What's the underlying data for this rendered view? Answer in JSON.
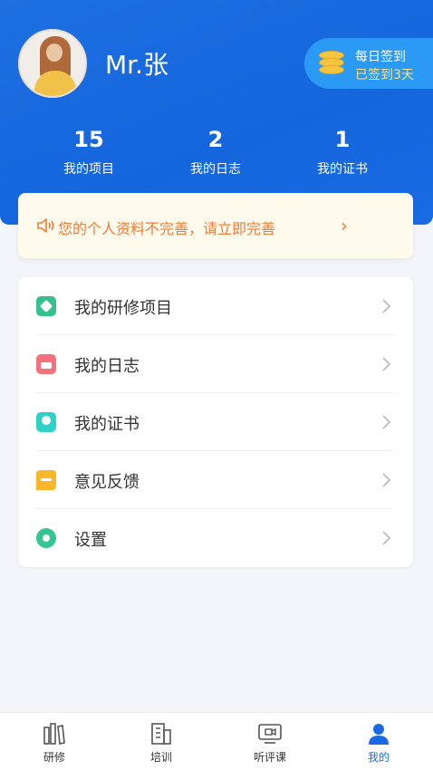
{
  "user": {
    "name": "Mr.张"
  },
  "checkin": {
    "title": "每日签到",
    "status": "已签到3天"
  },
  "stats": [
    {
      "value": "15",
      "label": "我的项目"
    },
    {
      "value": "2",
      "label": "我的日志"
    },
    {
      "value": "1",
      "label": "我的证书"
    }
  ],
  "notice": {
    "text": "您的个人资料不完善，请立即完善",
    "arrow": "›"
  },
  "menu": [
    {
      "label": "我的研修项目",
      "icon": "layers-icon",
      "color": "#37c08f"
    },
    {
      "label": "我的日志",
      "icon": "journal-icon",
      "color": "#f4727d"
    },
    {
      "label": "我的证书",
      "icon": "certificate-icon",
      "color": "#2fd0c5"
    },
    {
      "label": "意见反馈",
      "icon": "feedback-icon",
      "color": "#f8b62b"
    },
    {
      "label": "设置",
      "icon": "gear-icon",
      "color": "#36c490"
    }
  ],
  "tabs": [
    {
      "label": "研修",
      "icon": "books-icon"
    },
    {
      "label": "培训",
      "icon": "building-icon"
    },
    {
      "label": "听评课",
      "icon": "video-icon"
    },
    {
      "label": "我的",
      "icon": "person-icon",
      "active": true
    }
  ],
  "colors": {
    "primary": "#1a6ae3",
    "notice_text": "#f17b38"
  }
}
